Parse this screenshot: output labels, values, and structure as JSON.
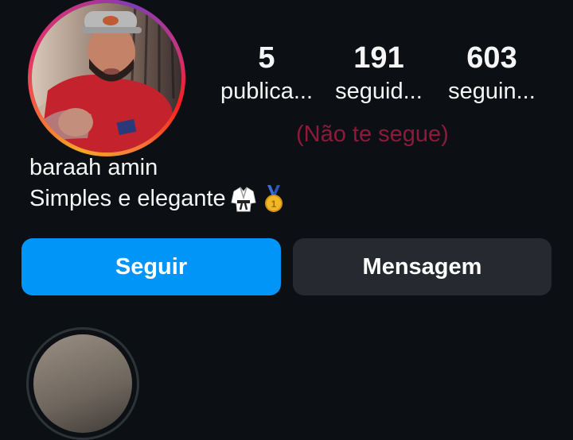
{
  "profile": {
    "username": "baraah amin",
    "bio": "Simples e elegante",
    "bio_emojis": [
      "martial-arts-uniform-emoji",
      "medal-emoji"
    ],
    "stats": [
      {
        "value": "5",
        "label": "publica..."
      },
      {
        "value": "191",
        "label": "seguid..."
      },
      {
        "value": "603",
        "label": "seguin..."
      }
    ],
    "relationship_notice": "(Não te segue)"
  },
  "actions": {
    "follow_label": "Seguir",
    "message_label": "Mensagem"
  },
  "colors": {
    "background": "#0c1014",
    "follow_button": "#0095f6",
    "message_button": "#262a30",
    "notice_text": "#8e1a3a"
  }
}
